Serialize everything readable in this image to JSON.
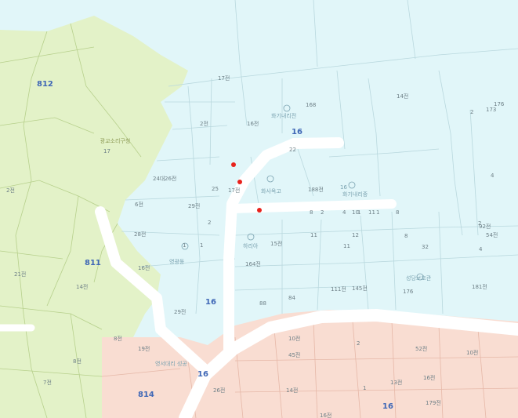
{
  "map": {
    "zones": [
      {
        "name": "green-zone",
        "color": "#e3f2c8"
      },
      {
        "name": "blue-zone",
        "color": "#e1f6f9"
      },
      {
        "name": "pink-zone",
        "color": "#f9ddd2"
      }
    ],
    "road_color": "#ffffff",
    "marker_color": "#e8221c",
    "block_labels": [
      "812",
      "811",
      "814",
      "16",
      "16",
      "16",
      "16"
    ],
    "poi_labels": [
      "화기내리전",
      "화사옥고",
      "영광동",
      "하리아",
      "화기내리중",
      "16",
      "성당보호관",
      "영서대리 성공"
    ],
    "park_label": "광교소리구청",
    "parcel_labels": [
      "2전",
      "17",
      "6전",
      "21전",
      "14전",
      "2전",
      "8전",
      "7전",
      "29전",
      "17전",
      "16전",
      "24대",
      "26전",
      "25",
      "1",
      "29전",
      "1",
      "16전",
      "8전",
      "19전",
      "26전",
      "14전",
      "16전",
      "10전",
      "45전",
      "2",
      "52전",
      "13전",
      "1",
      "179전",
      "16전",
      "8",
      "11",
      "32",
      "2",
      "4",
      "88",
      "84",
      "111전",
      "145전",
      "176",
      "181전",
      "4",
      "2",
      "164전",
      "11",
      "12",
      "22",
      "188전",
      "168",
      "14전",
      "17전",
      "28전",
      "2",
      "15전",
      "10전",
      "173",
      "176",
      "92전",
      "54전",
      "1",
      "8",
      "1",
      "4",
      "2",
      "8",
      "10",
      "11"
    ]
  }
}
